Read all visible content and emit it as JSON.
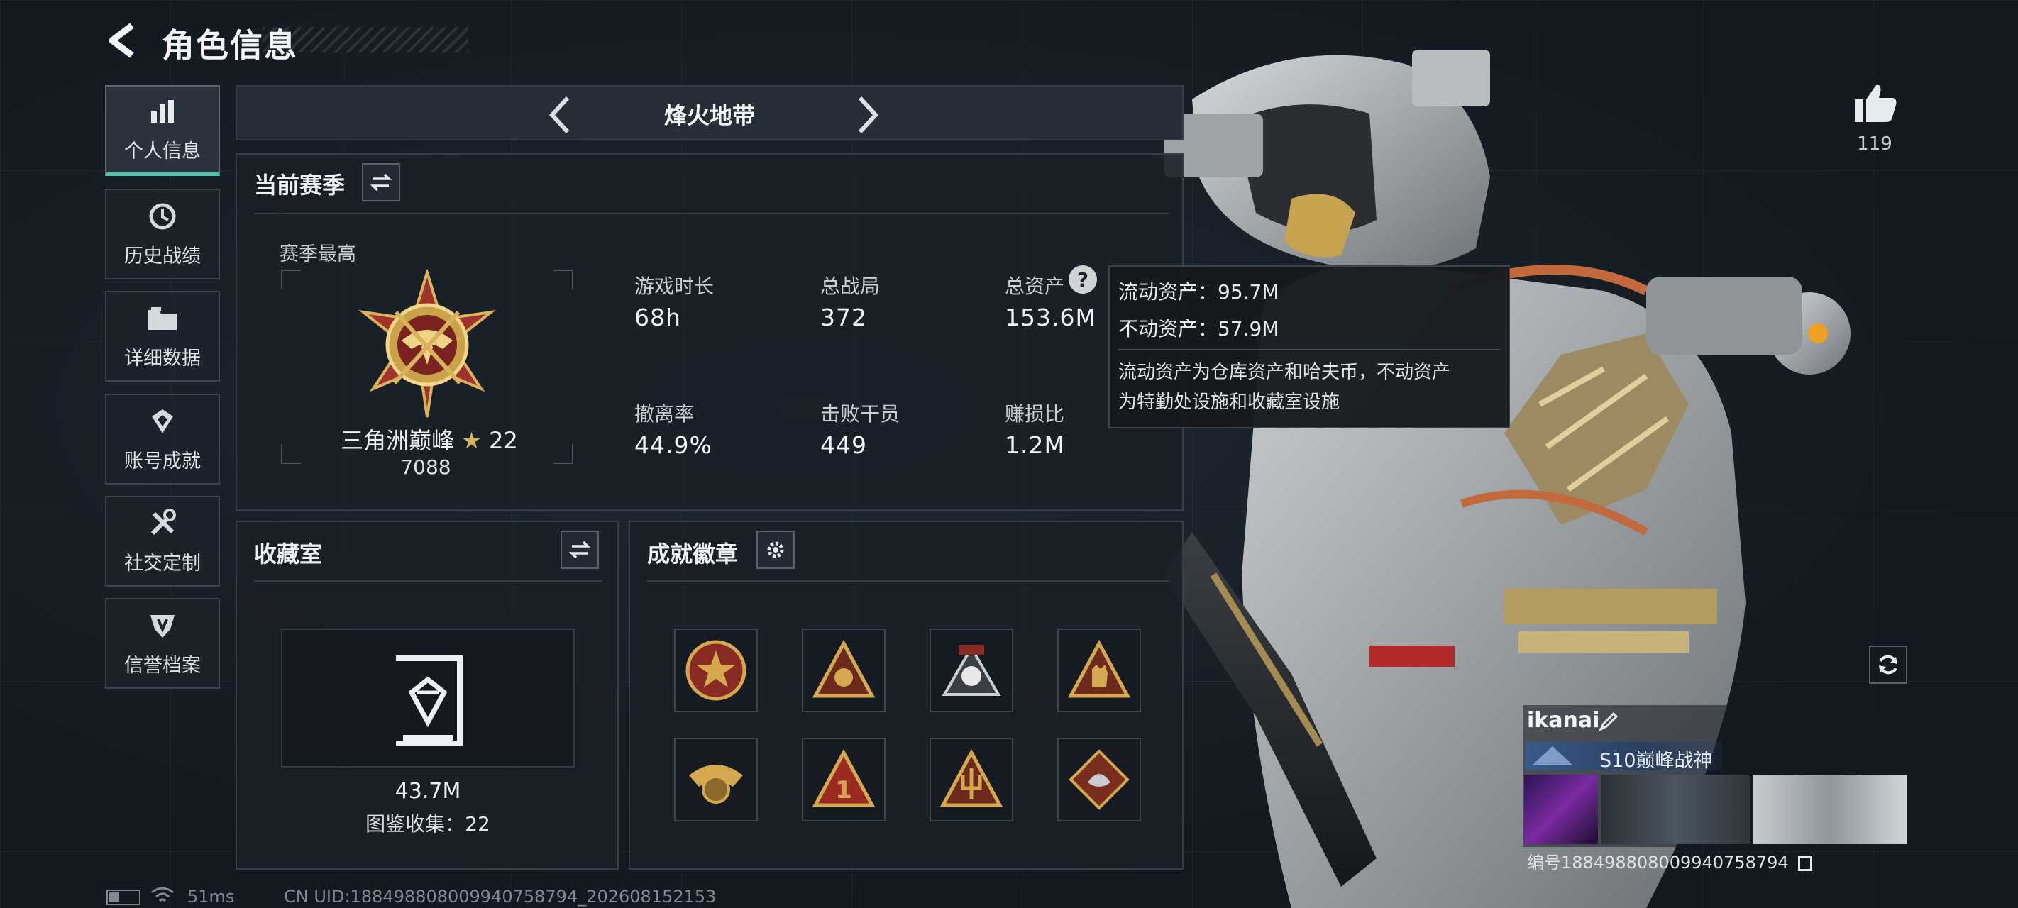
{
  "header": {
    "title": "角色信息"
  },
  "sidebar": {
    "items": [
      {
        "label": "个人信息",
        "icon": "bar-chart-icon",
        "active": true
      },
      {
        "label": "历史战绩",
        "icon": "history-icon"
      },
      {
        "label": "详细数据",
        "icon": "folder-icon"
      },
      {
        "label": "账号成就",
        "icon": "achievement-icon"
      },
      {
        "label": "社交定制",
        "icon": "tools-icon"
      },
      {
        "label": "信誉档案",
        "icon": "shield-icon"
      }
    ]
  },
  "mode": {
    "name": "烽火地带"
  },
  "season": {
    "title": "当前赛季",
    "best_label": "赛季最高",
    "rank_name": "三角洲巅峰",
    "rank_stars": "22",
    "rank_score": "7088",
    "stats": [
      {
        "label": "游戏时长",
        "value": "68h"
      },
      {
        "label": "总战局",
        "value": "372"
      },
      {
        "label": "总资产",
        "value": "153.6M"
      },
      {
        "label": "撤离率",
        "value": "44.9%"
      },
      {
        "label": "击败干员",
        "value": "449"
      },
      {
        "label": "赚损比",
        "value": "1.2M"
      }
    ]
  },
  "tooltip": {
    "liquid": "流动资产：95.7M",
    "fixed": "不动资产：57.9M",
    "desc_line1": "流动资产为仓库资产和哈夫币，不动资产",
    "desc_line2": "为特勤处设施和收藏室设施"
  },
  "collection": {
    "title": "收藏室",
    "value": "43.7M",
    "count_label": "图鉴收集：22"
  },
  "badges": {
    "title": "成就徽章",
    "items": [
      "badge-star-medal",
      "badge-triangle-skull",
      "badge-skull-crown",
      "badge-triangle-hand",
      "badge-eagle-gold",
      "badge-triangle-one",
      "badge-triangle-trident",
      "badge-dragon-diamond"
    ]
  },
  "profile": {
    "likes": "119",
    "name": "ikanai",
    "title": "S10巅峰战神",
    "uid_label": "编号18849880800994075879​4"
  },
  "status": {
    "ping": "51ms",
    "uid": "CN UID:18849880800994075879​4_202608152153"
  },
  "colors": {
    "accent": "#4fc3b0",
    "gold": "#c9a24a",
    "panel": "#1a2028"
  }
}
